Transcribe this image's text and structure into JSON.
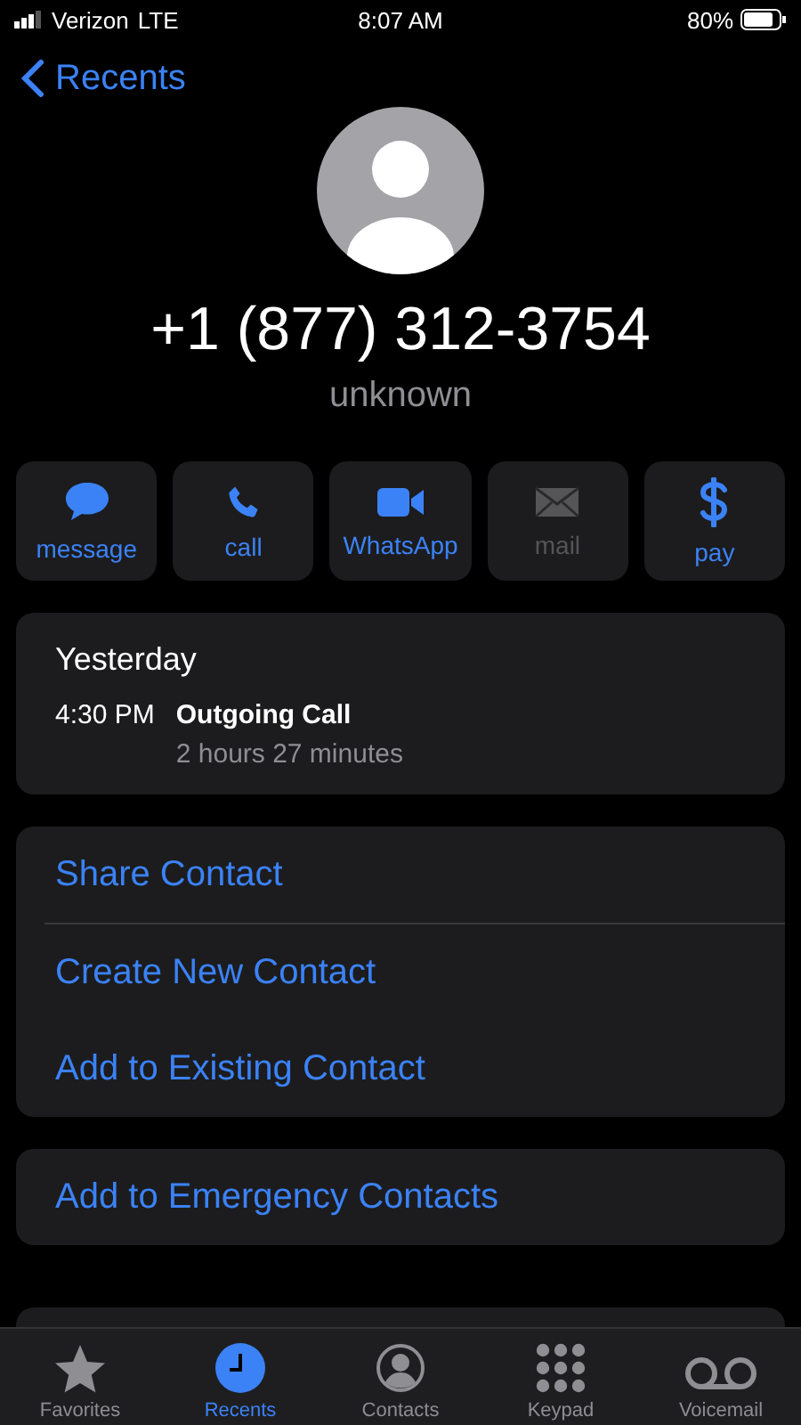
{
  "status_bar": {
    "carrier": "Verizon",
    "network": "LTE",
    "time": "8:07 AM",
    "battery": "80%"
  },
  "nav": {
    "back": "Recents"
  },
  "contact": {
    "number": "+1 (877) 312-3754",
    "label": "unknown"
  },
  "actions": [
    {
      "kind": "message",
      "label": "message",
      "disabled": false
    },
    {
      "kind": "call",
      "label": "call",
      "disabled": false
    },
    {
      "kind": "video",
      "label": "WhatsApp",
      "disabled": false
    },
    {
      "kind": "mail",
      "label": "mail",
      "disabled": true
    },
    {
      "kind": "pay",
      "label": "pay",
      "disabled": false
    }
  ],
  "call_history": {
    "day": "Yesterday",
    "entries": [
      {
        "time": "4:30 PM",
        "type": "Outgoing Call",
        "duration": "2 hours 27 minutes"
      }
    ]
  },
  "contact_options": [
    "Share Contact",
    "Create New Contact",
    "Add to Existing Contact"
  ],
  "emergency_option": "Add to Emergency Contacts",
  "tabs": [
    {
      "kind": "star",
      "label": "Favorites",
      "selected": false
    },
    {
      "kind": "clock",
      "label": "Recents",
      "selected": true
    },
    {
      "kind": "person",
      "label": "Contacts",
      "selected": false
    },
    {
      "kind": "keypad",
      "label": "Keypad",
      "selected": false
    },
    {
      "kind": "voicemail",
      "label": "Voicemail",
      "selected": false
    }
  ]
}
